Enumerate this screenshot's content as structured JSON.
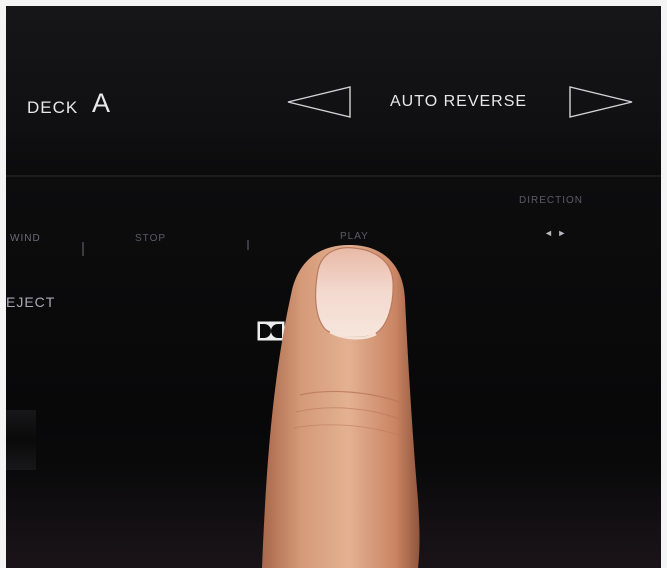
{
  "panel": {
    "deck_label": "DECK",
    "deck_letter": "A",
    "auto_reverse": "AUTO REVERSE",
    "rewind_label": "WIND",
    "stop_label": "STOP",
    "play_label": "PLAY",
    "direction_label": "DIRECTION",
    "direction_arrows": "◄ ►",
    "eject_label": "EJECT"
  },
  "colors": {
    "panel_background": "#0a0a0b",
    "label_text": "#e8e8ea",
    "faint_label_text": "#5b5c66",
    "finger_skin": "#d9a07c",
    "fingernail": "#efd2c6"
  },
  "icons": {
    "left_arrow": "triangle-left-outline-icon",
    "right_arrow": "triangle-right-outline-icon",
    "dolby_logo": "dolby-double-d-icon"
  }
}
